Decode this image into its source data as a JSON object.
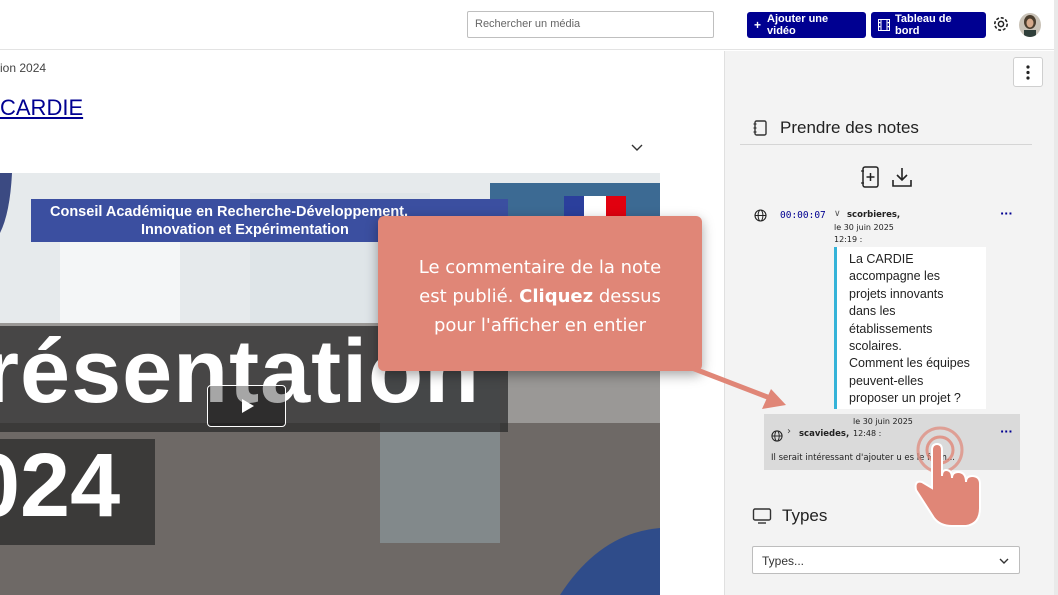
{
  "header": {
    "search_placeholder": "Rechercher un média",
    "add_video": "Ajouter une vidéo",
    "dashboard": "Tableau de bord",
    "icons": [
      "gear-icon",
      "avatar"
    ]
  },
  "page": {
    "breadcrumb_fragment": "ion 2024",
    "title_fragment": "CARDIE"
  },
  "video": {
    "banner_line1": "Conseil Académique en Recherche-Développement,",
    "banner_line2": "Innovation et Expérimentation",
    "overlay_word": "résentation",
    "overlay_year": "024"
  },
  "notes": {
    "heading": "Prendre des notes",
    "note1": {
      "timecode": "00:00:07",
      "author": "scorbieres,",
      "date": "le 30 juin 2025",
      "time": "12:19 :",
      "text_lines": [
        "La CARDIE",
        "accompagne les",
        "projets innovants",
        "dans les",
        "établissements",
        "scolaires.",
        "Comment les équipes",
        "peuvent-elles",
        "proposer un projet ?"
      ]
    },
    "note2": {
      "date": "le 30 juin 2025",
      "author": "scaviedes,",
      "time": "12:48 :",
      "comment": "Il serait intéressant d'ajouter u       es le form..."
    },
    "more_label": "···"
  },
  "types": {
    "heading": "Types",
    "select_value": "Types..."
  },
  "tooltip": {
    "line1": "Le commentaire de la note",
    "line2a": "est publié. ",
    "line2b": "Cliquez",
    "line2c": " dessus",
    "line3": "pour l'afficher en entier"
  },
  "colors": {
    "primary": "#000091",
    "accent": "#35b3d8",
    "tooltip": "#e08677"
  }
}
